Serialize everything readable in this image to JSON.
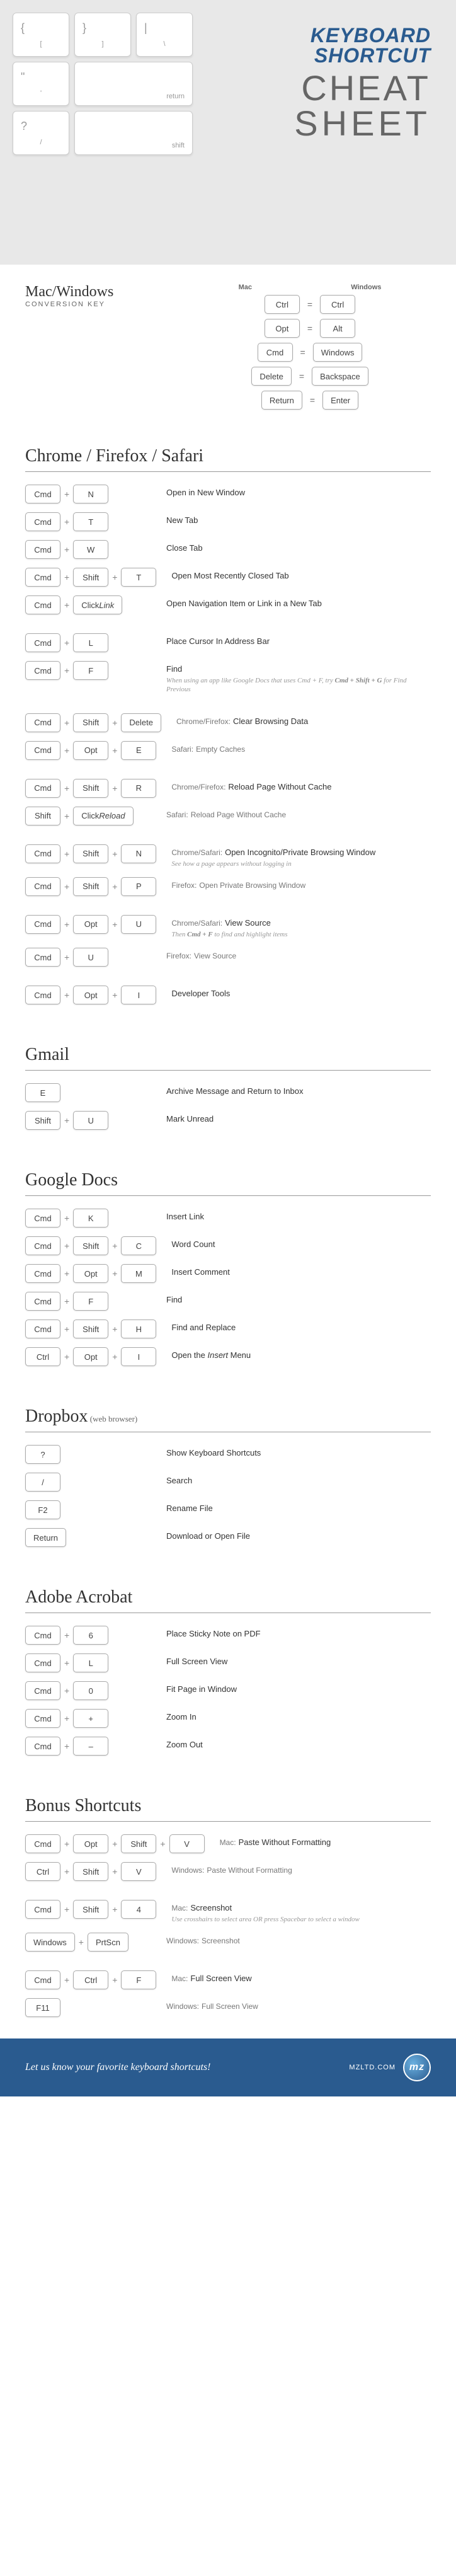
{
  "hero": {
    "bg_keys": [
      {
        "sym": "{",
        "label": "["
      },
      {
        "sym": "}",
        "label": "]"
      },
      {
        "sym": "|",
        "label": "\\"
      },
      {
        "sym": "\"",
        "label": "'"
      },
      {
        "label": "return",
        "wide": true
      },
      {
        "sym": "?",
        "label": "/"
      },
      {
        "label": "shift",
        "wide": true
      }
    ],
    "title1": "KEYBOARD",
    "title2": "SHORTCUT",
    "title3": "CHEAT",
    "title4": "SHEET"
  },
  "conversion": {
    "title": "Mac/Windows",
    "subtitle": "CONVERSION KEY",
    "head_mac": "Mac",
    "head_win": "Windows",
    "rows": [
      {
        "mac": "Ctrl",
        "win": "Ctrl"
      },
      {
        "mac": "Opt",
        "win": "Alt"
      },
      {
        "mac": "Cmd",
        "win": "Windows"
      },
      {
        "mac": "Delete",
        "win": "Backspace"
      },
      {
        "mac": "Return",
        "win": "Enter"
      }
    ]
  },
  "sections": [
    {
      "title": "Chrome / Firefox / Safari",
      "rows": [
        {
          "keys": [
            "Cmd",
            "N"
          ],
          "desc": "Open in New Window"
        },
        {
          "keys": [
            "Cmd",
            "T"
          ],
          "desc": "New Tab"
        },
        {
          "keys": [
            "Cmd",
            "W"
          ],
          "desc": "Close Tab"
        },
        {
          "keys": [
            "Cmd",
            "Shift",
            "T"
          ],
          "desc": "Open Most Recently Closed Tab"
        },
        {
          "keys": [
            "Cmd",
            "Click Link"
          ],
          "desc": "Open Navigation Item or Link in a New Tab"
        },
        {
          "spacer": true
        },
        {
          "keys": [
            "Cmd",
            "L"
          ],
          "desc": "Place Cursor In Address Bar"
        },
        {
          "keys": [
            "Cmd",
            "F"
          ],
          "desc": "Find",
          "note": "When using an app like Google Docs that uses Cmd + F, try <b>Cmd + Shift + G</b> for Find Previous"
        },
        {
          "spacer": true
        },
        {
          "keys": [
            "Cmd",
            "Shift",
            "Delete"
          ],
          "prefix": "Chrome/Firefox:",
          "desc": "Clear Browsing Data"
        },
        {
          "keys": [
            "Cmd",
            "Opt",
            "E"
          ],
          "prefix": "Safari:",
          "desc_light": "Empty Caches"
        },
        {
          "spacer": true
        },
        {
          "keys": [
            "Cmd",
            "Shift",
            "R"
          ],
          "prefix": "Chrome/Firefox:",
          "desc": "Reload Page Without Cache"
        },
        {
          "keys": [
            "Shift",
            "Click Reload"
          ],
          "prefix": "Safari:",
          "desc_light": "Reload Page Without Cache"
        },
        {
          "spacer": true
        },
        {
          "keys": [
            "Cmd",
            "Shift",
            "N"
          ],
          "prefix": "Chrome/Safari:",
          "desc": "Open Incognito/Private Browsing Window",
          "note": "See how a page appears without logging in"
        },
        {
          "keys": [
            "Cmd",
            "Shift",
            "P"
          ],
          "prefix": "Firefox:",
          "desc_light": "Open Private Browsing Window"
        },
        {
          "spacer": true
        },
        {
          "keys": [
            "Cmd",
            "Opt",
            "U"
          ],
          "prefix": "Chrome/Safari:",
          "desc": "View Source",
          "note": "Then <b>Cmd + F</b> to find and highlight items"
        },
        {
          "keys": [
            "Cmd",
            "U"
          ],
          "prefix": "Firefox:",
          "desc_light": "View Source"
        },
        {
          "spacer": true
        },
        {
          "keys": [
            "Cmd",
            "Opt",
            "I"
          ],
          "desc": "Developer Tools"
        }
      ]
    },
    {
      "title": "Gmail",
      "rows": [
        {
          "keys": [
            "E"
          ],
          "desc": "Archive Message and Return to Inbox"
        },
        {
          "keys": [
            "Shift",
            "U"
          ],
          "desc": "Mark Unread"
        }
      ]
    },
    {
      "title": "Google Docs",
      "rows": [
        {
          "keys": [
            "Cmd",
            "K"
          ],
          "desc": "Insert Link"
        },
        {
          "keys": [
            "Cmd",
            "Shift",
            "C"
          ],
          "desc": "Word Count"
        },
        {
          "keys": [
            "Cmd",
            "Opt",
            "M"
          ],
          "desc": "Insert Comment"
        },
        {
          "keys": [
            "Cmd",
            "F"
          ],
          "desc": "Find"
        },
        {
          "keys": [
            "Cmd",
            "Shift",
            "H"
          ],
          "desc": "Find and Replace"
        },
        {
          "keys": [
            "Ctrl",
            "Opt",
            "I"
          ],
          "desc": "Open the <i>Insert</i> Menu"
        }
      ]
    },
    {
      "title": "Dropbox",
      "sub": "(web browser)",
      "rows": [
        {
          "keys": [
            "?"
          ],
          "desc": "Show Keyboard Shortcuts"
        },
        {
          "keys": [
            "/"
          ],
          "desc": "Search"
        },
        {
          "keys": [
            "F2"
          ],
          "desc": "Rename File"
        },
        {
          "keys": [
            "Return"
          ],
          "desc": "Download or Open File"
        }
      ]
    },
    {
      "title": "Adobe Acrobat",
      "rows": [
        {
          "keys": [
            "Cmd",
            "6"
          ],
          "desc": "Place Sticky Note on PDF"
        },
        {
          "keys": [
            "Cmd",
            "L"
          ],
          "desc": "Full Screen View"
        },
        {
          "keys": [
            "Cmd",
            "0"
          ],
          "desc": "Fit Page in Window"
        },
        {
          "keys": [
            "Cmd",
            "+"
          ],
          "desc": "Zoom In"
        },
        {
          "keys": [
            "Cmd",
            "–"
          ],
          "desc": "Zoom Out"
        }
      ]
    },
    {
      "title": "Bonus Shortcuts",
      "rows": [
        {
          "keys": [
            "Cmd",
            "Opt",
            "Shift",
            "V"
          ],
          "prefix": "Mac:",
          "desc": "Paste Without Formatting"
        },
        {
          "keys": [
            "Ctrl",
            "Shift",
            "V"
          ],
          "prefix": "Windows:",
          "desc_light": "Paste Without Formatting"
        },
        {
          "spacer": true
        },
        {
          "keys": [
            "Cmd",
            "Shift",
            "4"
          ],
          "prefix": "Mac:",
          "desc": "Screenshot",
          "note": "Use crosshairs to select area OR press Spacebar to select a window"
        },
        {
          "keys": [
            "Windows",
            "PrtScn"
          ],
          "prefix": "Windows:",
          "desc_light": "Screenshot"
        },
        {
          "spacer": true
        },
        {
          "keys": [
            "Cmd",
            "Ctrl",
            "F"
          ],
          "prefix": "Mac:",
          "desc": "Full Screen View"
        },
        {
          "keys": [
            "F11"
          ],
          "prefix": "Windows:",
          "desc_light": "Full Screen View"
        }
      ]
    }
  ],
  "footer": {
    "text": "Let us know your favorite keyboard shortcuts!",
    "site": "MZLTD.COM",
    "logo": "mz"
  }
}
